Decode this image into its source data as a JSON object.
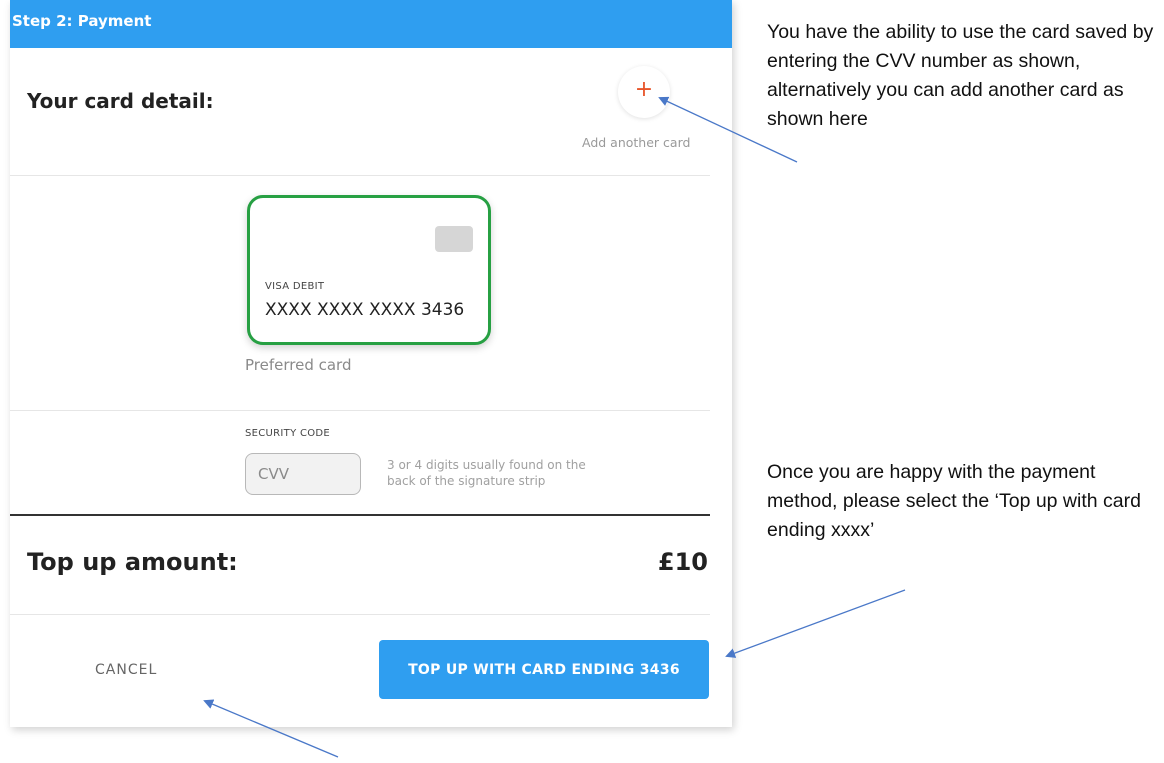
{
  "header": {
    "title": "Step 2: Payment"
  },
  "card_section": {
    "label": "Your card detail:",
    "add_card_icon": "plus-icon",
    "add_card_label": "Add another card"
  },
  "card": {
    "type": "VISA DEBIT",
    "number": "XXXX XXXX XXXX 3436",
    "preferred_label": "Preferred card"
  },
  "security": {
    "label": "SECURITY CODE",
    "placeholder": "CVV",
    "hint": "3 or 4 digits usually found on the back of the signature strip"
  },
  "topup": {
    "label": "Top up amount:",
    "amount": "£10"
  },
  "actions": {
    "cancel_label": "CANCEL",
    "topup_label": "TOP UP WITH CARD ENDING 3436"
  },
  "annotations": {
    "card_note": "You have the ability to use the card saved by entering the CVV number as shown, alternatively you can add another card as shown here",
    "topup_note": "Once you are happy with the payment method, please select the ‘Top up with card ending xxxx’"
  },
  "colors": {
    "accent_blue": "#2f9ef0",
    "card_border_green": "#27a043",
    "plus_orange": "#e8552a",
    "arrow_blue": "#4a78c8"
  }
}
